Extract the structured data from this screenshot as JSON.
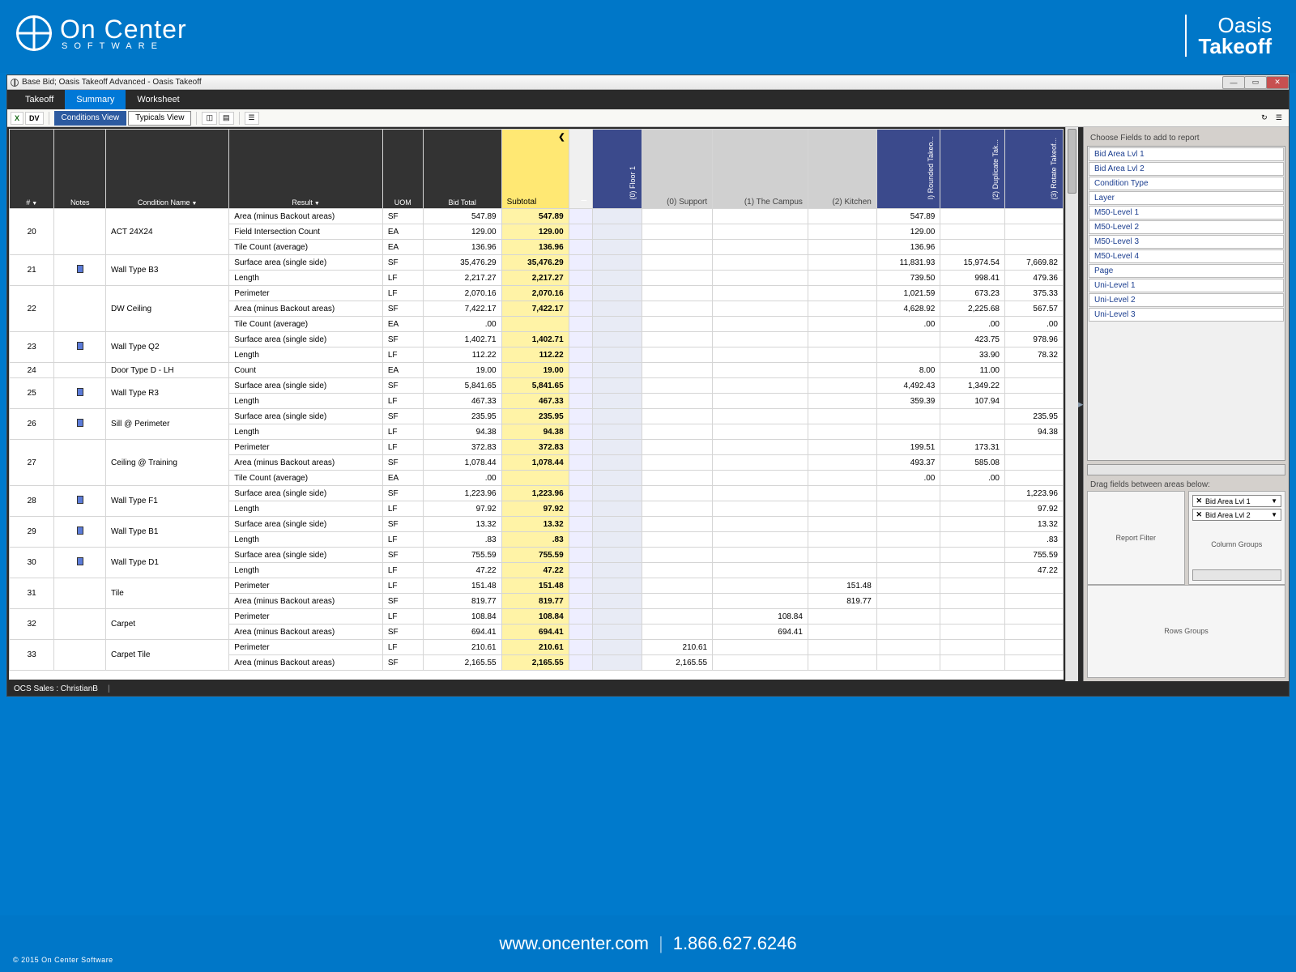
{
  "brand": {
    "company": "On Center",
    "companySub": "SOFTWARE",
    "product1": "Oasis",
    "product2": "Takeoff"
  },
  "window": {
    "title": "Base Bid; Oasis Takeoff Advanced - Oasis Takeoff",
    "tabs": [
      "Takeoff",
      "Summary",
      "Worksheet"
    ],
    "activeTab": "Summary",
    "views": [
      "Conditions View",
      "Typicals View"
    ],
    "activeView": "Conditions View"
  },
  "grid": {
    "headers": {
      "num": "#",
      "notes": "Notes",
      "condName": "Condition Name",
      "result": "Result",
      "uom": "UOM",
      "bidTotal": "Bid Total",
      "subtotal": "Subtotal"
    },
    "groupCols": [
      {
        "label": "(0) Floor 1",
        "cls": "hdr-vert"
      },
      {
        "label": "(0) Support",
        "cls": "hdr-vert-grey"
      },
      {
        "label": "(1) The Campus",
        "cls": "hdr-vert-grey"
      },
      {
        "label": "(2) Kitchen",
        "cls": "hdr-vert-grey"
      },
      {
        "label": "I) Rounded Takeo...",
        "cls": "hdr-vert"
      },
      {
        "label": "(2) Duplicate Tak...",
        "cls": "hdr-vert"
      },
      {
        "label": "(3) Rotate Takeof...",
        "cls": "hdr-vert"
      }
    ],
    "rows": [
      {
        "num": "20",
        "note": false,
        "cond": "ACT 24X24",
        "lines": [
          {
            "result": "Area (minus Backout areas)",
            "uom": "SF",
            "bid": "547.89",
            "sub": "547.89",
            "c": [
              "",
              "",
              "",
              "",
              "547.89",
              "",
              ""
            ]
          },
          {
            "result": "Field Intersection Count",
            "uom": "EA",
            "bid": "129.00",
            "sub": "129.00",
            "c": [
              "",
              "",
              "",
              "",
              "129.00",
              "",
              ""
            ]
          },
          {
            "result": "Tile Count (average)",
            "uom": "EA",
            "bid": "136.96",
            "sub": "136.96",
            "c": [
              "",
              "",
              "",
              "",
              "136.96",
              "",
              ""
            ]
          }
        ]
      },
      {
        "num": "21",
        "note": true,
        "cond": "Wall Type B3",
        "lines": [
          {
            "result": "Surface area (single side)",
            "uom": "SF",
            "bid": "35,476.29",
            "sub": "35,476.29",
            "c": [
              "",
              "",
              "",
              "",
              "11,831.93",
              "15,974.54",
              "7,669.82"
            ]
          },
          {
            "result": "Length",
            "uom": "LF",
            "bid": "2,217.27",
            "sub": "2,217.27",
            "c": [
              "",
              "",
              "",
              "",
              "739.50",
              "998.41",
              "479.36"
            ]
          }
        ]
      },
      {
        "num": "22",
        "note": false,
        "cond": "DW Ceiling",
        "lines": [
          {
            "result": "Perimeter",
            "uom": "LF",
            "bid": "2,070.16",
            "sub": "2,070.16",
            "c": [
              "",
              "",
              "",
              "",
              "1,021.59",
              "673.23",
              "375.33"
            ]
          },
          {
            "result": "Area (minus Backout areas)",
            "uom": "SF",
            "bid": "7,422.17",
            "sub": "7,422.17",
            "c": [
              "",
              "",
              "",
              "",
              "4,628.92",
              "2,225.68",
              "567.57"
            ]
          },
          {
            "result": "Tile Count (average)",
            "uom": "EA",
            "bid": ".00",
            "sub": "",
            "c": [
              "",
              "",
              "",
              "",
              ".00",
              ".00",
              ".00"
            ]
          }
        ]
      },
      {
        "num": "23",
        "note": true,
        "cond": "Wall Type Q2",
        "lines": [
          {
            "result": "Surface area (single side)",
            "uom": "SF",
            "bid": "1,402.71",
            "sub": "1,402.71",
            "c": [
              "",
              "",
              "",
              "",
              "",
              "423.75",
              "978.96"
            ]
          },
          {
            "result": "Length",
            "uom": "LF",
            "bid": "112.22",
            "sub": "112.22",
            "c": [
              "",
              "",
              "",
              "",
              "",
              "33.90",
              "78.32"
            ]
          }
        ]
      },
      {
        "num": "24",
        "note": false,
        "cond": "Door Type D - LH",
        "lines": [
          {
            "result": "Count",
            "uom": "EA",
            "bid": "19.00",
            "sub": "19.00",
            "c": [
              "",
              "",
              "",
              "",
              "8.00",
              "11.00",
              ""
            ]
          }
        ]
      },
      {
        "num": "25",
        "note": true,
        "cond": "Wall Type R3",
        "lines": [
          {
            "result": "Surface area (single side)",
            "uom": "SF",
            "bid": "5,841.65",
            "sub": "5,841.65",
            "c": [
              "",
              "",
              "",
              "",
              "4,492.43",
              "1,349.22",
              ""
            ]
          },
          {
            "result": "Length",
            "uom": "LF",
            "bid": "467.33",
            "sub": "467.33",
            "c": [
              "",
              "",
              "",
              "",
              "359.39",
              "107.94",
              ""
            ]
          }
        ]
      },
      {
        "num": "26",
        "note": true,
        "cond": "Sill @ Perimeter",
        "lines": [
          {
            "result": "Surface area (single side)",
            "uom": "SF",
            "bid": "235.95",
            "sub": "235.95",
            "c": [
              "",
              "",
              "",
              "",
              "",
              "",
              "235.95"
            ]
          },
          {
            "result": "Length",
            "uom": "LF",
            "bid": "94.38",
            "sub": "94.38",
            "c": [
              "",
              "",
              "",
              "",
              "",
              "",
              "94.38"
            ]
          }
        ]
      },
      {
        "num": "27",
        "note": false,
        "cond": "Ceiling @ Training",
        "lines": [
          {
            "result": "Perimeter",
            "uom": "LF",
            "bid": "372.83",
            "sub": "372.83",
            "c": [
              "",
              "",
              "",
              "",
              "199.51",
              "173.31",
              ""
            ]
          },
          {
            "result": "Area (minus Backout areas)",
            "uom": "SF",
            "bid": "1,078.44",
            "sub": "1,078.44",
            "c": [
              "",
              "",
              "",
              "",
              "493.37",
              "585.08",
              ""
            ]
          },
          {
            "result": "Tile Count (average)",
            "uom": "EA",
            "bid": ".00",
            "sub": "",
            "c": [
              "",
              "",
              "",
              "",
              ".00",
              ".00",
              ""
            ]
          }
        ]
      },
      {
        "num": "28",
        "note": true,
        "cond": "Wall Type F1",
        "lines": [
          {
            "result": "Surface area (single side)",
            "uom": "SF",
            "bid": "1,223.96",
            "sub": "1,223.96",
            "c": [
              "",
              "",
              "",
              "",
              "",
              "",
              "1,223.96"
            ]
          },
          {
            "result": "Length",
            "uom": "LF",
            "bid": "97.92",
            "sub": "97.92",
            "c": [
              "",
              "",
              "",
              "",
              "",
              "",
              "97.92"
            ]
          }
        ]
      },
      {
        "num": "29",
        "note": true,
        "cond": "Wall Type B1",
        "lines": [
          {
            "result": "Surface area (single side)",
            "uom": "SF",
            "bid": "13.32",
            "sub": "13.32",
            "c": [
              "",
              "",
              "",
              "",
              "",
              "",
              "13.32"
            ]
          },
          {
            "result": "Length",
            "uom": "LF",
            "bid": ".83",
            "sub": ".83",
            "c": [
              "",
              "",
              "",
              "",
              "",
              "",
              ".83"
            ]
          }
        ]
      },
      {
        "num": "30",
        "note": true,
        "cond": "Wall Type D1",
        "lines": [
          {
            "result": "Surface area (single side)",
            "uom": "SF",
            "bid": "755.59",
            "sub": "755.59",
            "c": [
              "",
              "",
              "",
              "",
              "",
              "",
              "755.59"
            ]
          },
          {
            "result": "Length",
            "uom": "LF",
            "bid": "47.22",
            "sub": "47.22",
            "c": [
              "",
              "",
              "",
              "",
              "",
              "",
              "47.22"
            ]
          }
        ]
      },
      {
        "num": "31",
        "note": false,
        "cond": "Tile",
        "lines": [
          {
            "result": "Perimeter",
            "uom": "LF",
            "bid": "151.48",
            "sub": "151.48",
            "c": [
              "",
              "",
              "",
              "151.48",
              "",
              "",
              ""
            ]
          },
          {
            "result": "Area (minus Backout areas)",
            "uom": "SF",
            "bid": "819.77",
            "sub": "819.77",
            "c": [
              "",
              "",
              "",
              "819.77",
              "",
              "",
              ""
            ]
          }
        ]
      },
      {
        "num": "32",
        "note": false,
        "cond": "Carpet",
        "lines": [
          {
            "result": "Perimeter",
            "uom": "LF",
            "bid": "108.84",
            "sub": "108.84",
            "c": [
              "",
              "",
              "108.84",
              "",
              "",
              "",
              ""
            ]
          },
          {
            "result": "Area (minus Backout areas)",
            "uom": "SF",
            "bid": "694.41",
            "sub": "694.41",
            "c": [
              "",
              "",
              "694.41",
              "",
              "",
              "",
              ""
            ]
          }
        ]
      },
      {
        "num": "33",
        "note": false,
        "cond": "Carpet Tile",
        "lines": [
          {
            "result": "Perimeter",
            "uom": "LF",
            "bid": "210.61",
            "sub": "210.61",
            "c": [
              "",
              "210.61",
              "",
              "",
              "",
              "",
              ""
            ]
          },
          {
            "result": "Area (minus Backout areas)",
            "uom": "SF",
            "bid": "2,165.55",
            "sub": "2,165.55",
            "c": [
              "",
              "2,165.55",
              "",
              "",
              "",
              "",
              ""
            ]
          }
        ]
      }
    ]
  },
  "rightPanel": {
    "title": "Choose Fields to add to report",
    "fields": [
      "Bid Area Lvl 1",
      "Bid Area Lvl 2",
      "Condition Type",
      "Layer",
      "M50-Level 1",
      "M50-Level 2",
      "M50-Level 3",
      "M50-Level 4",
      "Page",
      "Uni-Level 1",
      "Uni-Level 2",
      "Uni-Level 3"
    ],
    "dragLabel": "Drag fields between areas below:",
    "areas": {
      "filter": "Report Filter",
      "cols": "Column Groups",
      "rows": "Rows Groups"
    },
    "colTags": [
      "Bid Area Lvl 1",
      "Bid Area Lvl 2"
    ]
  },
  "status": {
    "user": "OCS Sales : ChristianB"
  },
  "footer": {
    "url": "www.oncenter.com",
    "phone": "1.866.627.6246",
    "copy": "© 2015 On Center Software"
  }
}
